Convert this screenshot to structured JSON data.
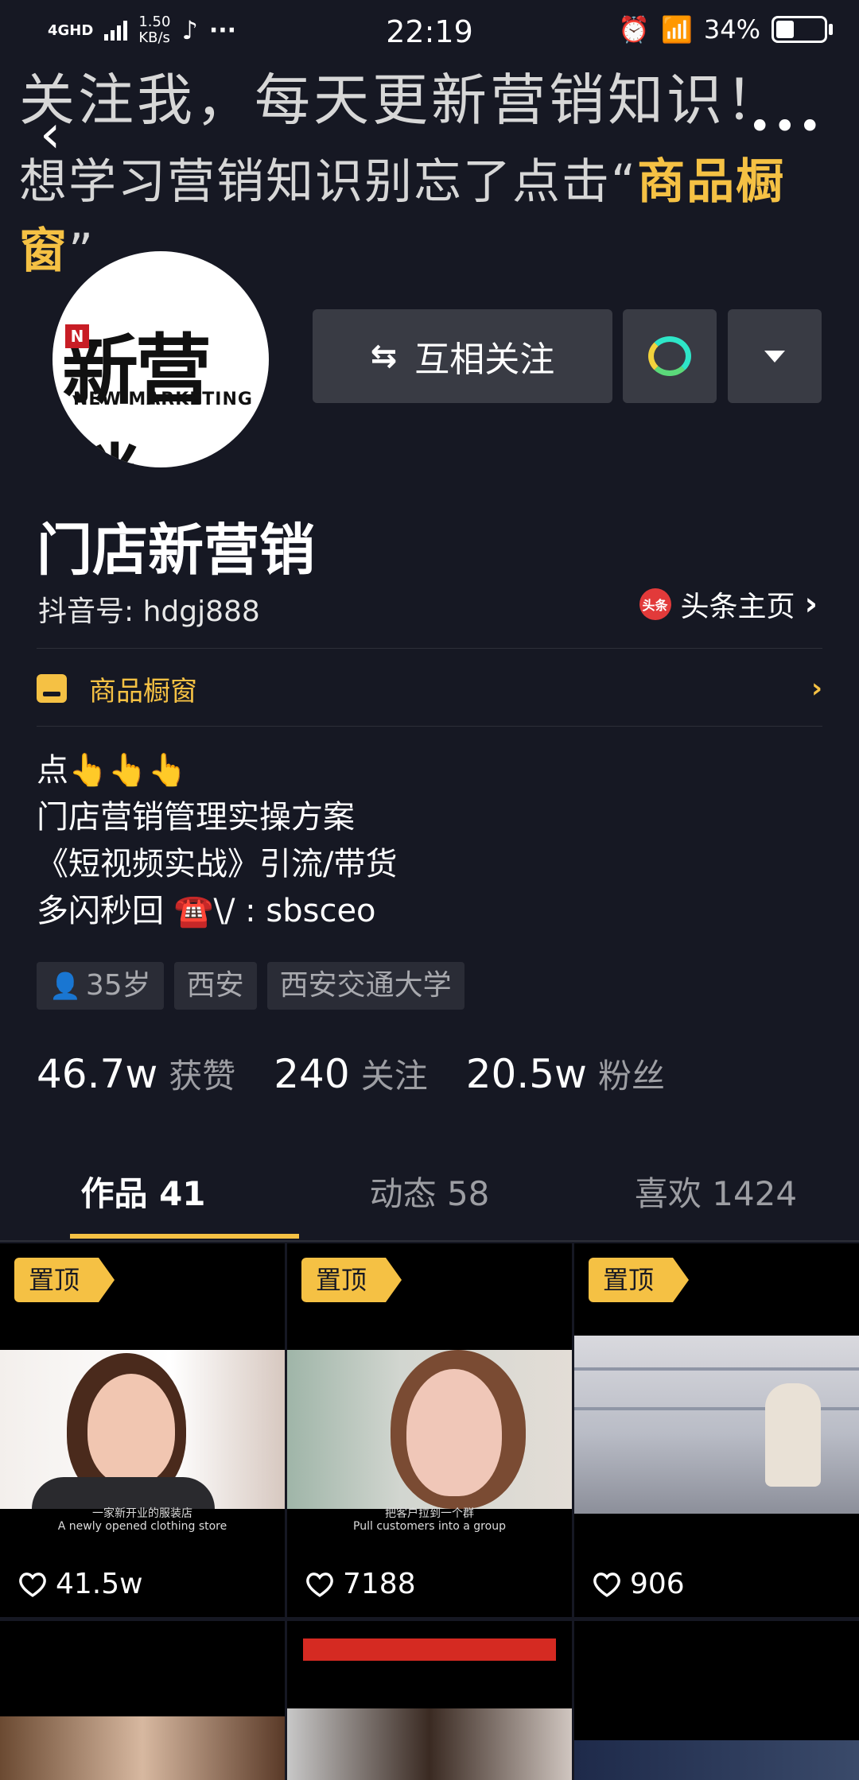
{
  "status_bar": {
    "network": "4GHD",
    "speed": "1.50\nKB/s",
    "dots": "···",
    "time": "22:19",
    "battery": "34%"
  },
  "banner": {
    "line1": "关注我，每天更新营销知识！",
    "line2_prefix": "想学习营销知识别忘了点击“",
    "line2_highlight": "商品橱窗",
    "line2_suffix": "”"
  },
  "avatar": {
    "logo_text": "新营销",
    "logo_sub": "NEW MARKETING",
    "logo_mark": "N"
  },
  "actions": {
    "follow_label": "互相关注"
  },
  "profile": {
    "name": "门店新营销",
    "douyin_id": "抖音号: hdgj888",
    "toutiao_icon_text": "头条",
    "toutiao_label": "头条主页",
    "shop_label": "商品橱窗"
  },
  "bio": {
    "line1": "点👆👆👆",
    "line2": "门店营销管理实操方案",
    "line3": "《短视频实战》引流/带货",
    "line4": "多闪秒回 ☎️\\/ : sbsceo"
  },
  "tags": [
    "35岁",
    "西安",
    "西安交通大学"
  ],
  "stats": [
    {
      "num": "46.7w",
      "label": "获赞"
    },
    {
      "num": "240",
      "label": "关注"
    },
    {
      "num": "20.5w",
      "label": "粉丝"
    }
  ],
  "tabs": [
    {
      "label": "作品 41",
      "active": true
    },
    {
      "label": "动态 58",
      "active": false
    },
    {
      "label": "喜欢 1424",
      "active": false
    }
  ],
  "videos": [
    {
      "pinned": "置顶",
      "likes": "41.5w",
      "caption": "一家新开业的服装店\nA newly opened clothing store"
    },
    {
      "pinned": "置顶",
      "likes": "7188",
      "caption": "把客户拉到一个群\nPull customers into a group"
    },
    {
      "pinned": "置顶",
      "likes": "906",
      "caption": ""
    }
  ],
  "colors": {
    "background": "#161823",
    "accent": "#f5c144",
    "button": "#393b44"
  }
}
